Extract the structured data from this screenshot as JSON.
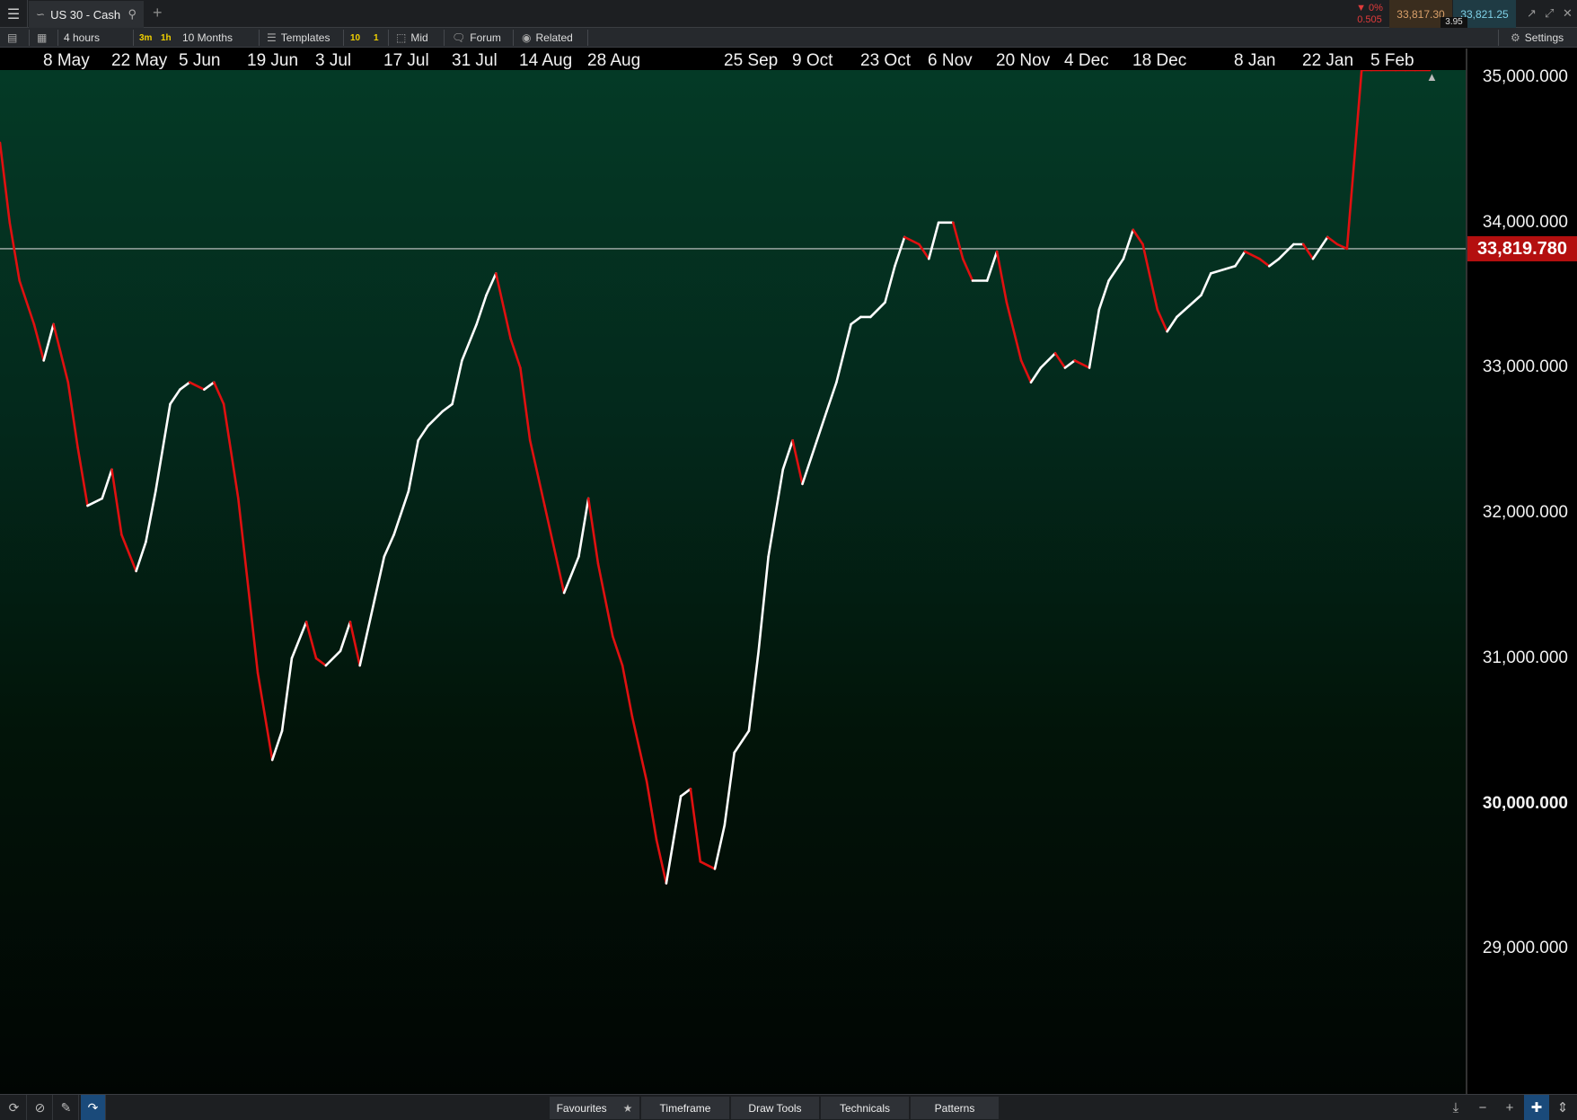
{
  "tabbar": {
    "instrument_tab": "US 30 - Cash",
    "new_tab": "+",
    "change_percent": "▼ 0%",
    "change_value": "0.505",
    "sell_price": "33,817.30",
    "buy_price": "33,821.25",
    "spread": "3.95"
  },
  "toolbar": {
    "interval": "4 hours",
    "quick_3m": "3m",
    "quick_1h": "1h",
    "range": "10 Months",
    "templates": "Templates",
    "badge_10": "10",
    "badge_1": "1",
    "mid": "Mid",
    "forum": "Forum",
    "related": "Related",
    "settings": "Settings"
  },
  "date_axis": [
    "8 May",
    "22 May",
    "5 Jun",
    "19 Jun",
    "3 Jul",
    "17 Jul",
    "31 Jul",
    "14 Aug",
    "28 Aug",
    "25 Sep",
    "9 Oct",
    "23 Oct",
    "6 Nov",
    "20 Nov",
    "4 Dec",
    "18 Dec",
    "8 Jan",
    "22 Jan",
    "5 Feb"
  ],
  "price_axis": [
    {
      "label": "35,000.000",
      "value": 35000,
      "bold": false
    },
    {
      "label": "34,000.000",
      "value": 34000,
      "bold": false
    },
    {
      "label": "33,000.000",
      "value": 33000,
      "bold": false
    },
    {
      "label": "32,000.000",
      "value": 32000,
      "bold": false
    },
    {
      "label": "31,000.000",
      "value": 31000,
      "bold": false
    },
    {
      "label": "30,000.000",
      "value": 30000,
      "bold": true
    },
    {
      "label": "29,000.000",
      "value": 29000,
      "bold": false
    }
  ],
  "current_price": {
    "label": "33,819.780",
    "value": 33819.78
  },
  "colors": {
    "up": "#ffffff",
    "down": "#e01010",
    "price_line": "#d0d0d0",
    "current_price_bg": "#b40f0f"
  },
  "bottombar": {
    "favourites": "Favourites",
    "timeframe": "Timeframe",
    "draw_tools": "Draw Tools",
    "technicals": "Technicals",
    "patterns": "Patterns"
  },
  "chart_data": {
    "type": "line",
    "instrument": "US 30 - Cash",
    "interval": "4 hours",
    "range": "10 Months",
    "x": [
      "2023-04-24",
      "2023-04-26",
      "2023-04-28",
      "2023-05-01",
      "2023-05-03",
      "2023-05-05",
      "2023-05-08",
      "2023-05-10",
      "2023-05-12",
      "2023-05-15",
      "2023-05-17",
      "2023-05-19",
      "2023-05-22",
      "2023-05-24",
      "2023-05-26",
      "2023-05-29",
      "2023-05-31",
      "2023-06-02",
      "2023-06-05",
      "2023-06-07",
      "2023-06-09",
      "2023-06-12",
      "2023-06-14",
      "2023-06-16",
      "2023-06-19",
      "2023-06-21",
      "2023-06-23",
      "2023-06-26",
      "2023-06-28",
      "2023-06-30",
      "2023-07-03",
      "2023-07-05",
      "2023-07-07",
      "2023-07-10",
      "2023-07-12",
      "2023-07-14",
      "2023-07-17",
      "2023-07-19",
      "2023-07-21",
      "2023-07-24",
      "2023-07-26",
      "2023-07-28",
      "2023-07-31",
      "2023-08-02",
      "2023-08-04",
      "2023-08-07",
      "2023-08-09",
      "2023-08-11",
      "2023-08-14",
      "2023-08-16",
      "2023-08-18",
      "2023-08-21",
      "2023-08-23",
      "2023-08-25",
      "2023-08-28",
      "2023-08-30",
      "2023-09-01",
      "2023-09-04",
      "2023-09-06",
      "2023-09-08",
      "2023-09-11",
      "2023-09-13",
      "2023-09-15",
      "2023-09-18",
      "2023-09-20",
      "2023-09-22",
      "2023-09-25",
      "2023-09-27",
      "2023-09-29",
      "2023-10-02",
      "2023-10-04",
      "2023-10-06",
      "2023-10-09",
      "2023-10-11",
      "2023-10-13",
      "2023-10-16",
      "2023-10-18",
      "2023-10-20",
      "2023-10-23",
      "2023-10-25",
      "2023-10-27",
      "2023-10-30",
      "2023-11-01",
      "2023-11-03",
      "2023-11-06",
      "2023-11-08",
      "2023-11-10",
      "2023-11-13",
      "2023-11-15",
      "2023-11-17",
      "2023-11-20",
      "2023-11-22",
      "2023-11-24",
      "2023-11-27",
      "2023-11-29",
      "2023-12-01",
      "2023-12-04",
      "2023-12-06",
      "2023-12-08",
      "2023-12-11",
      "2023-12-13",
      "2023-12-15",
      "2023-12-18",
      "2023-12-20",
      "2023-12-22",
      "2023-12-27",
      "2023-12-29",
      "2024-01-03",
      "2024-01-05",
      "2024-01-08",
      "2024-01-10",
      "2024-01-12",
      "2024-01-15",
      "2024-01-17",
      "2024-01-19",
      "2024-01-22",
      "2024-01-24",
      "2024-01-26",
      "2024-01-29",
      "2024-01-31",
      "2024-02-02",
      "2024-02-05",
      "2024-02-07",
      "2024-02-09",
      "2024-02-12"
    ],
    "y": [
      34550,
      34000,
      33600,
      33300,
      33050,
      33300,
      32900,
      32450,
      32050,
      32100,
      32300,
      31850,
      31600,
      31800,
      32150,
      32750,
      32850,
      32900,
      32850,
      32900,
      32750,
      32100,
      31500,
      30900,
      30300,
      30500,
      31000,
      31250,
      31000,
      30950,
      31050,
      31250,
      30950,
      31400,
      31700,
      31850,
      32150,
      32500,
      32600,
      32700,
      32750,
      33050,
      33300,
      33500,
      33650,
      33200,
      33000,
      32500,
      32050,
      31750,
      31450,
      31700,
      32100,
      31650,
      31150,
      30950,
      30600,
      30150,
      29750,
      29450,
      30050,
      30100,
      29600,
      29550,
      29850,
      30350,
      30500,
      31050,
      31700,
      32300,
      32500,
      32200,
      32500,
      32700,
      32900,
      33300,
      33350,
      33350,
      33450,
      33700,
      33900,
      33850,
      33750,
      34000,
      34000,
      33750,
      33600,
      33600,
      33800,
      33450,
      33050,
      32900,
      33000,
      33100,
      33000,
      33050,
      33000,
      33400,
      33600,
      33750,
      33950,
      33850,
      33400,
      33250,
      33350,
      33500,
      33650,
      33700,
      33800,
      33750,
      33700,
      33750,
      33850,
      33850,
      33750,
      33900,
      33850,
      33819.78
    ],
    "xlim": [
      "2023-04-24",
      "2024-02-12"
    ],
    "ylim": [
      28000,
      35050
    ],
    "last_value": 33819.78,
    "grid": false,
    "legend": "none",
    "colors": {
      "up": "#ffffff",
      "down": "#e01010"
    }
  }
}
